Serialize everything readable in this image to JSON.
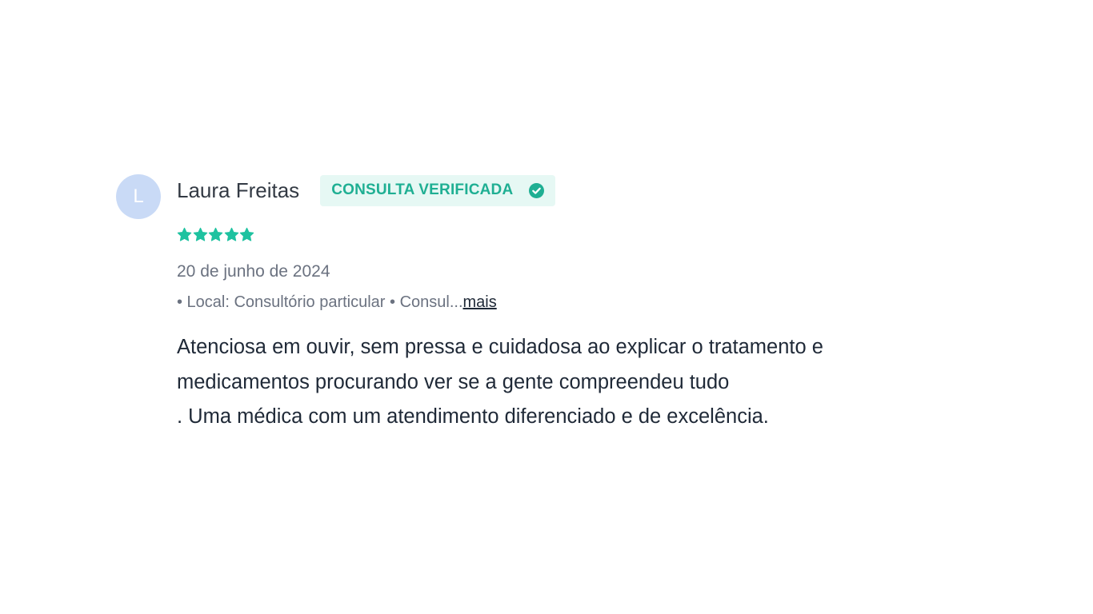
{
  "review": {
    "avatar_initial": "L",
    "author": "Laura Freitas",
    "badge_label": "CONSULTA VERIFICADA",
    "rating": 5,
    "rating_max": 5,
    "date": "20 de junho de 2024",
    "meta_text": "• Local: Consultório particular • Consul...",
    "more_label": "mais",
    "body_lines": [
      "Atenciosa em ouvir, sem pressa e cuidadosa ao explicar o tratamento e",
      "medicamentos procurando ver se a gente compreendeu tudo",
      ". Uma médica com um atendimento diferenciado e de excelência."
    ]
  },
  "colors": {
    "accent": "#1faf93",
    "star": "#1ec2a0",
    "badge_bg": "#e6f8f4",
    "avatar_bg": "#c9daf6"
  },
  "icons": {
    "badge": "check-circle-icon",
    "rating": "star-icon"
  }
}
